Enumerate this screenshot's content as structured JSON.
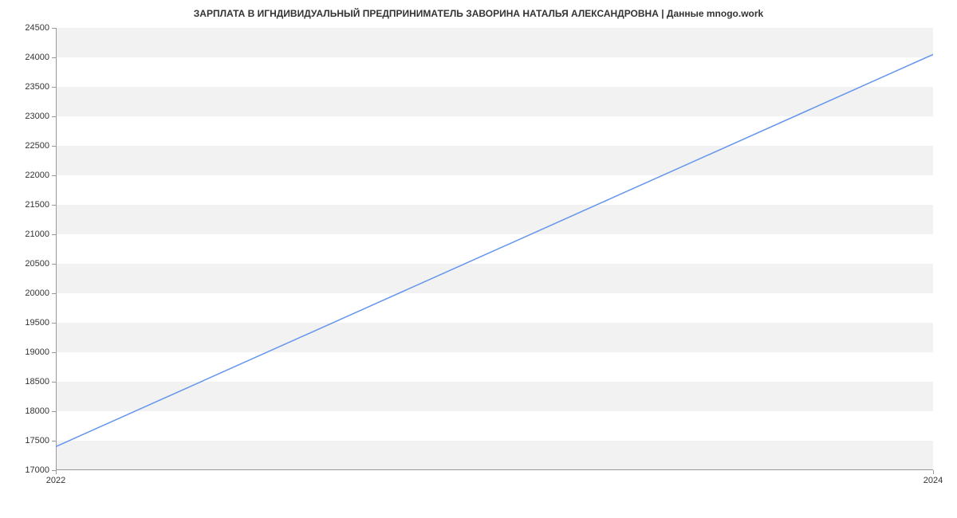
{
  "chart_data": {
    "type": "line",
    "title": "ЗАРПЛАТА В ИГНДИВИДУАЛЬНЫЙ ПРЕДПРИНИМАТЕЛЬ ЗАВОРИНА НАТАЛЬЯ АЛЕКСАНДРОВНА | Данные mnogo.work",
    "xlabel": "",
    "ylabel": "",
    "x": [
      2022,
      2024
    ],
    "values": [
      17400,
      24050
    ],
    "x_ticks": [
      2022,
      2024
    ],
    "y_ticks": [
      17000,
      17500,
      18000,
      18500,
      19000,
      19500,
      20000,
      20500,
      21000,
      21500,
      22000,
      22500,
      23000,
      23500,
      24000,
      24500
    ],
    "ylim": [
      17000,
      24500
    ],
    "xlim": [
      2022,
      2024
    ],
    "line_color": "#6495ed"
  }
}
